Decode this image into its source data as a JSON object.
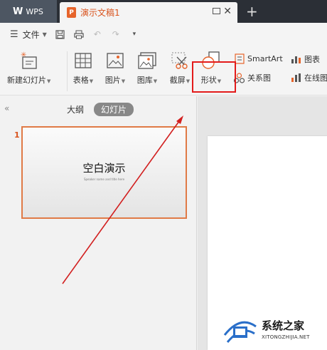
{
  "titlebar": {
    "app_logo": "W",
    "app_name": "WPS",
    "doc_icon_letter": "P",
    "doc_title": "演示文稿1",
    "new_tab": "+"
  },
  "menubar": {
    "file_label": "文件"
  },
  "ribbon": {
    "new_slide": "新建幻灯片",
    "table": "表格",
    "picture": "图片",
    "gallery": "图库",
    "screenshot": "截屏",
    "shape": "形状",
    "smartart": "SmartArt",
    "relation": "关系图",
    "chart": "图表",
    "online_chart": "在线图"
  },
  "panel": {
    "outline_tab": "大纲",
    "slides_tab": "幻灯片",
    "slide_number": "1",
    "slide_title": "空白演示",
    "slide_subtitle": "Speaker name and title here"
  },
  "watermark": {
    "name": "系统之家",
    "url": "XITONGZHIJIA.NET"
  },
  "colors": {
    "accent": "#d9541e",
    "highlight": "#e31b1b",
    "titlebar": "#2b2f36"
  }
}
